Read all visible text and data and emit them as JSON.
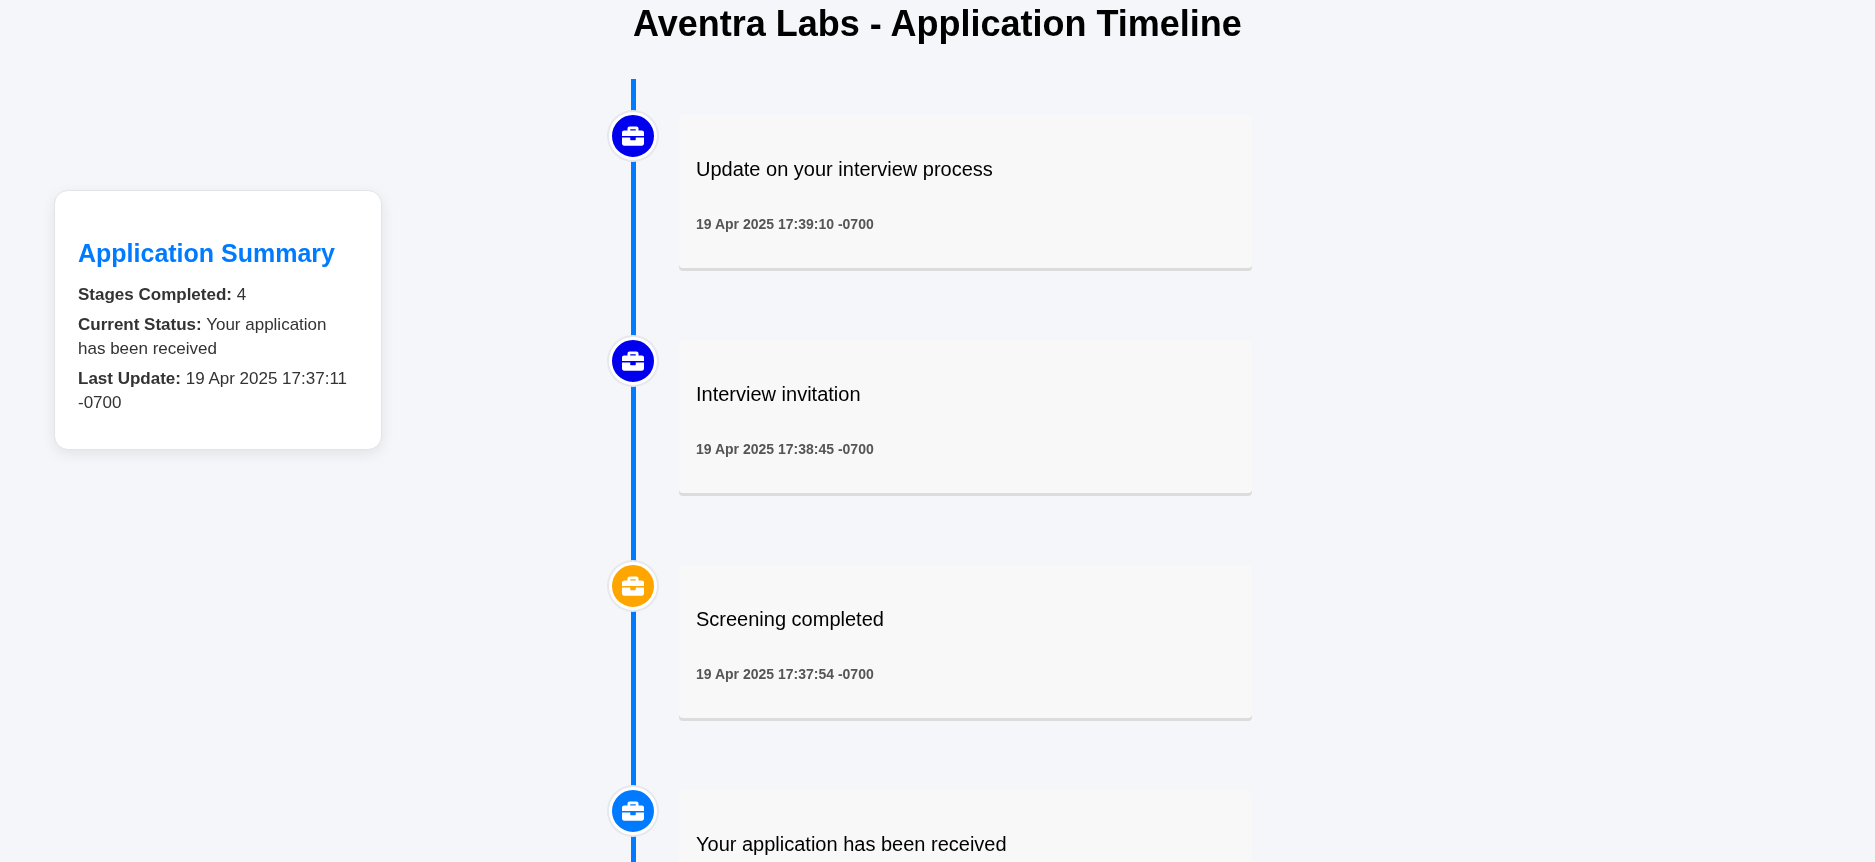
{
  "page_title": "Aventra Labs - Application Timeline",
  "summary": {
    "title": "Application Summary",
    "fields": [
      {
        "label": "Stages Completed:",
        "value": "4"
      },
      {
        "label": "Current Status:",
        "value": "Your application has been received"
      },
      {
        "label": "Last Update:",
        "value": "19 Apr 2025 17:37:11 -0700"
      }
    ]
  },
  "timeline": [
    {
      "title": "Update on your interview process",
      "date": "19 Apr 2025 17:39:10 -0700",
      "color": "#0000ee"
    },
    {
      "title": "Interview invitation",
      "date": "19 Apr 2025 17:38:45 -0700",
      "color": "#0000ee"
    },
    {
      "title": "Screening completed",
      "date": "19 Apr 2025 17:37:54 -0700",
      "color": "#ffa500"
    },
    {
      "title": "Your application has been received",
      "color": "#007bff"
    }
  ]
}
